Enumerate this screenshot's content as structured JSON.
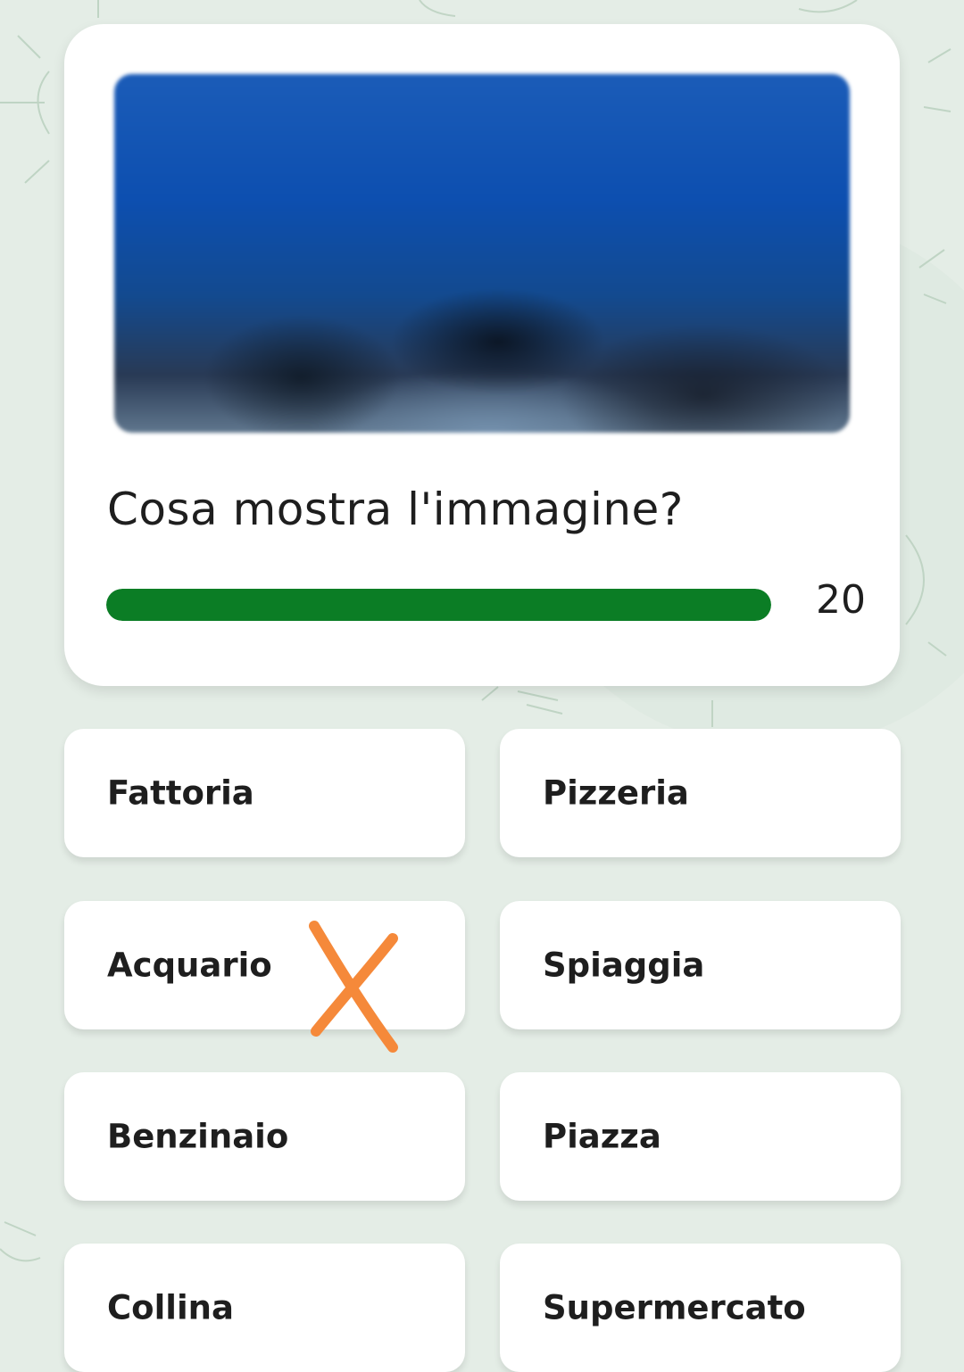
{
  "question": {
    "text": "Cosa mostra l'immagine?",
    "image_alt": "blurred-aquarium-photo",
    "timer": {
      "value": "20",
      "progress": 1.0,
      "color": "#0b7d25"
    }
  },
  "answers": [
    {
      "label": "Fattoria"
    },
    {
      "label": "Pizzeria"
    },
    {
      "label": "Acquario"
    },
    {
      "label": "Spiaggia"
    },
    {
      "label": "Benzinaio"
    },
    {
      "label": "Piazza"
    },
    {
      "label": "Collina"
    },
    {
      "label": "Supermercato"
    }
  ],
  "annotation": {
    "mark": "x-mark",
    "color": "#f5893a"
  }
}
